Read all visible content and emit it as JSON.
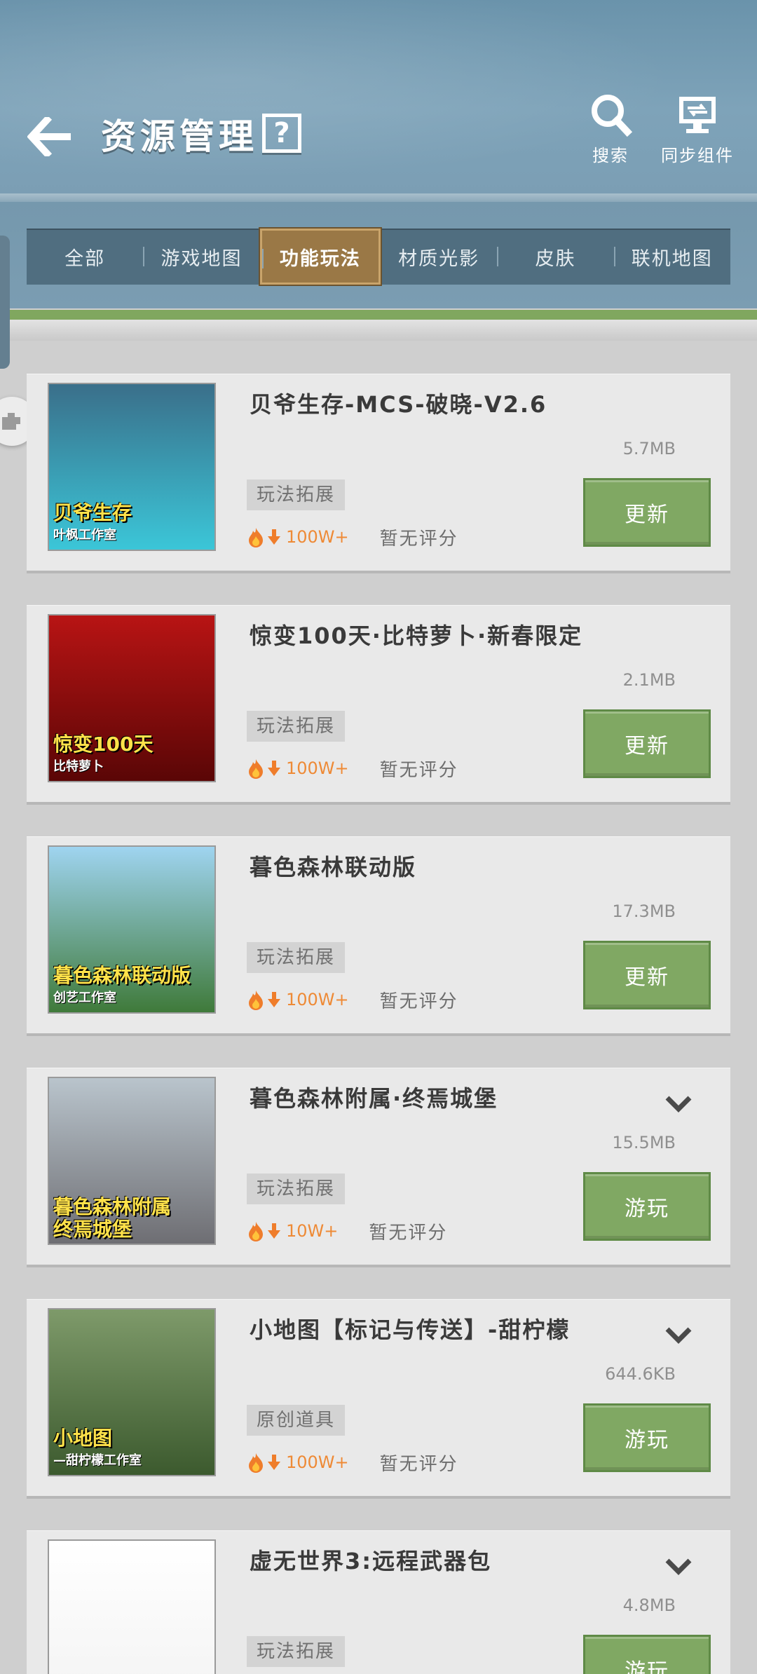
{
  "header": {
    "title": "资源管理",
    "help_label": "?",
    "search_label": "搜索",
    "sync_label": "同步组件"
  },
  "tabs": [
    {
      "label": "全部",
      "active": false
    },
    {
      "label": "游戏地图",
      "active": false
    },
    {
      "label": "功能玩法",
      "active": true
    },
    {
      "label": "材质光影",
      "active": false
    },
    {
      "label": "皮肤",
      "active": false
    },
    {
      "label": "联机地图",
      "active": false
    }
  ],
  "items": [
    {
      "title": "贝爷生存-MCS-破晓-V2.6",
      "size": "5.7MB",
      "tag": "玩法拓展",
      "downloads": "100W+",
      "rating": "暂无评分",
      "action": "更新",
      "thumb_caption": "贝爷生存",
      "thumb_sub": "叶枫工作室",
      "thumb_colors": [
        "#3a6f8a",
        "#3bc6d8"
      ]
    },
    {
      "title": "惊变100天·比特萝卜·新春限定",
      "size": "2.1MB",
      "tag": "玩法拓展",
      "downloads": "100W+",
      "rating": "暂无评分",
      "action": "更新",
      "thumb_caption": "惊变100天",
      "thumb_sub": "比特萝卜",
      "thumb_colors": [
        "#b81414",
        "#5a0606"
      ]
    },
    {
      "title": "暮色森林联动版",
      "size": "17.3MB",
      "tag": "玩法拓展",
      "downloads": "100W+",
      "rating": "暂无评分",
      "action": "更新",
      "thumb_caption": "暮色森林联动版",
      "thumb_sub": "创艺工作室",
      "thumb_colors": [
        "#9fd4f0",
        "#3f7a3a"
      ]
    },
    {
      "title": "暮色森林附属·终焉城堡",
      "size": "15.5MB",
      "tag": "玩法拓展",
      "downloads": "10W+",
      "rating": "暂无评分",
      "action": "游玩",
      "thumb_caption": "暮色森林附属\n终焉城堡",
      "thumb_sub": "",
      "thumb_colors": [
        "#b9c4cc",
        "#6e6e73"
      ]
    },
    {
      "title": "小地图【标记与传送】-甜柠檬",
      "size": "644.6KB",
      "tag": "原创道具",
      "downloads": "100W+",
      "rating": "暂无评分",
      "action": "游玩",
      "thumb_caption": "小地图",
      "thumb_sub": "—甜柠檬工作室",
      "thumb_colors": [
        "#7e9a6a",
        "#3c5a2e"
      ]
    },
    {
      "title": "虚无世界3:远程武器包",
      "size": "4.8MB",
      "tag": "玩法拓展",
      "downloads": "",
      "rating": "",
      "action": "游玩",
      "thumb_caption": "",
      "thumb_sub": "",
      "thumb_colors": [
        "#ffffff",
        "#f3f3f3"
      ]
    }
  ],
  "colors": {
    "accent_green": "#80a863",
    "tab_active": "#9a7846",
    "header_blue": "#6a93ab"
  }
}
